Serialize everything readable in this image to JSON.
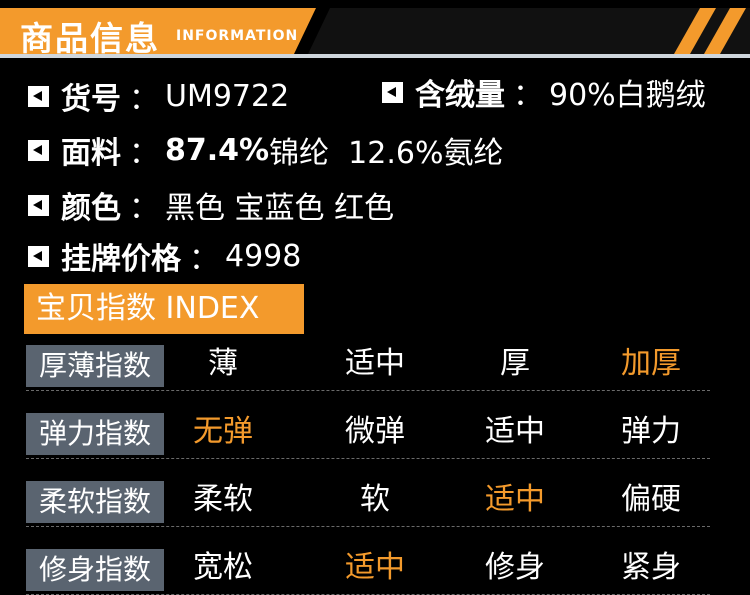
{
  "header": {
    "title": "商品信息",
    "subtitle": "INFORMATION"
  },
  "info": {
    "item_no": {
      "label": "货号",
      "colon": "：",
      "value": "UM9722"
    },
    "down": {
      "label": "含绒量",
      "colon": "：",
      "value": "90%白鹅绒"
    },
    "fabric": {
      "label": "面料",
      "colon": "：",
      "value_a": "87.4%",
      "value_b": "锦纶  12.6%氨纶"
    },
    "color": {
      "label": "颜色",
      "colon": "：",
      "value": "黑色 宝蓝色 红色"
    },
    "price": {
      "label": "挂牌价格",
      "colon": "：",
      "value": "4998"
    }
  },
  "index": {
    "title": "宝贝指数 INDEX",
    "rows": [
      {
        "label": "厚薄指数",
        "options": [
          "薄",
          "适中",
          "厚",
          "加厚"
        ],
        "selected": 3
      },
      {
        "label": "弹力指数",
        "options": [
          "无弹",
          "微弹",
          "适中",
          "弹力"
        ],
        "selected": 0
      },
      {
        "label": "柔软指数",
        "options": [
          "柔软",
          "软",
          "适中",
          "偏硬"
        ],
        "selected": 2
      },
      {
        "label": "修身指数",
        "options": [
          "宽松",
          "适中",
          "修身",
          "紧身"
        ],
        "selected": 1
      }
    ]
  },
  "colors": {
    "accent": "#f39a2c",
    "label_bg": "#5a6470",
    "background": "#000000",
    "text": "#ffffff"
  }
}
